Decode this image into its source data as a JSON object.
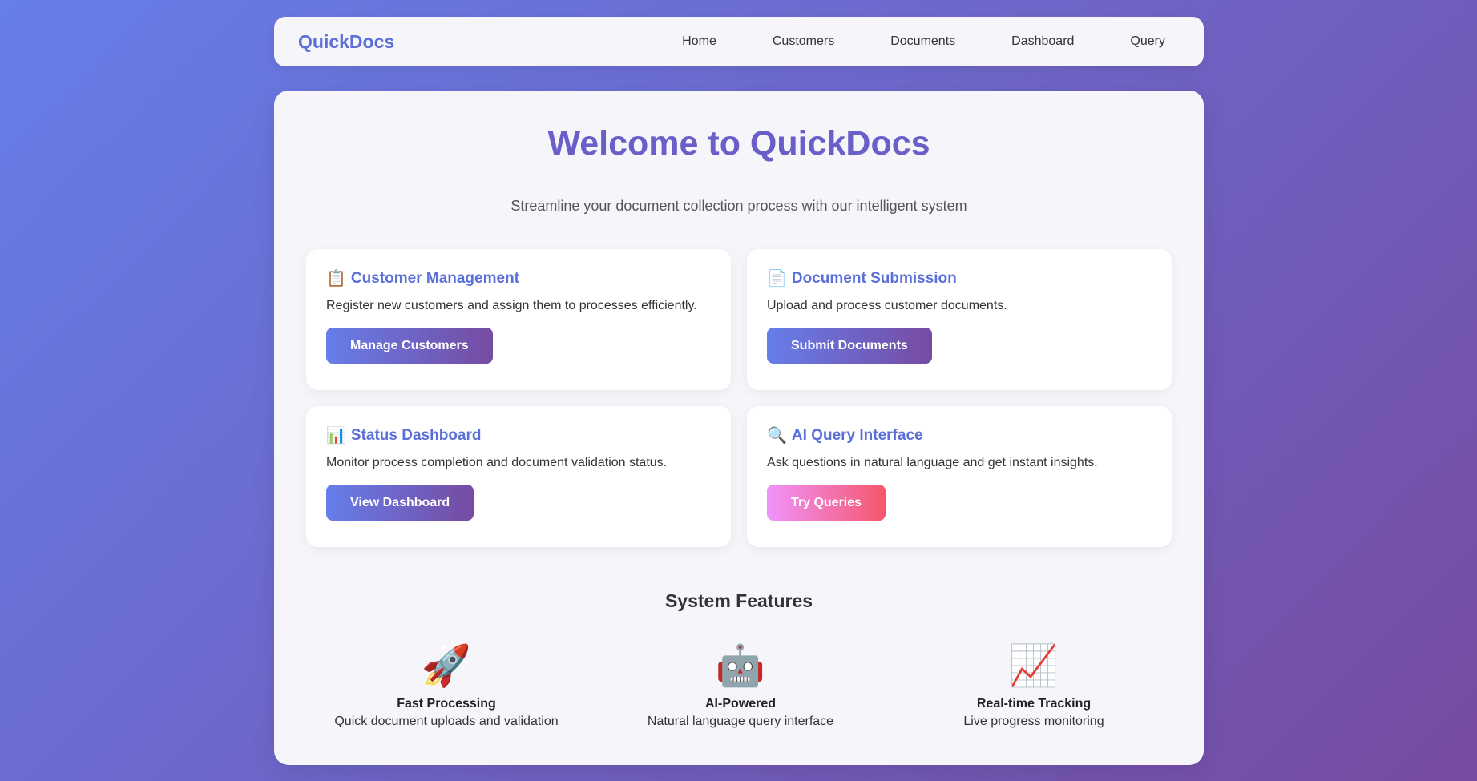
{
  "nav": {
    "brand": "QuickDocs",
    "links": [
      "Home",
      "Customers",
      "Documents",
      "Dashboard",
      "Query"
    ]
  },
  "hero": {
    "title": "Welcome to QuickDocs",
    "subtitle": "Streamline your document collection process with our intelligent system"
  },
  "cards": [
    {
      "icon": "clipboard-icon",
      "glyph": "📋",
      "title": "Customer Management",
      "desc": "Register new customers and assign them to processes efficiently.",
      "button": "Manage Customers"
    },
    {
      "icon": "document-icon",
      "glyph": "📄",
      "title": "Document Submission",
      "desc": "Upload and process customer documents.",
      "button": "Submit Documents"
    },
    {
      "icon": "bar-chart-icon",
      "glyph": "📊",
      "title": "Status Dashboard",
      "desc": "Monitor process completion and document validation status.",
      "button": "View Dashboard"
    },
    {
      "icon": "magnifier-icon",
      "glyph": "🔍",
      "title": "AI Query Interface",
      "desc": "Ask questions in natural language and get instant insights.",
      "button": "Try Queries"
    }
  ],
  "features": {
    "heading": "System Features",
    "items": [
      {
        "icon": "rocket-icon",
        "glyph": "🚀",
        "name": "Fast Processing",
        "desc": "Quick document uploads and validation"
      },
      {
        "icon": "robot-icon",
        "glyph": "🤖",
        "name": "AI-Powered",
        "desc": "Natural language query interface"
      },
      {
        "icon": "trending-chart-icon",
        "glyph": "📈",
        "name": "Real-time Tracking",
        "desc": "Live progress monitoring"
      }
    ]
  },
  "colors": {
    "accent": "#5b6fd8",
    "gradient_start": "#667eea",
    "gradient_end": "#764ba2",
    "query_button_start": "#f093fb",
    "query_button_end": "#f5576c"
  }
}
